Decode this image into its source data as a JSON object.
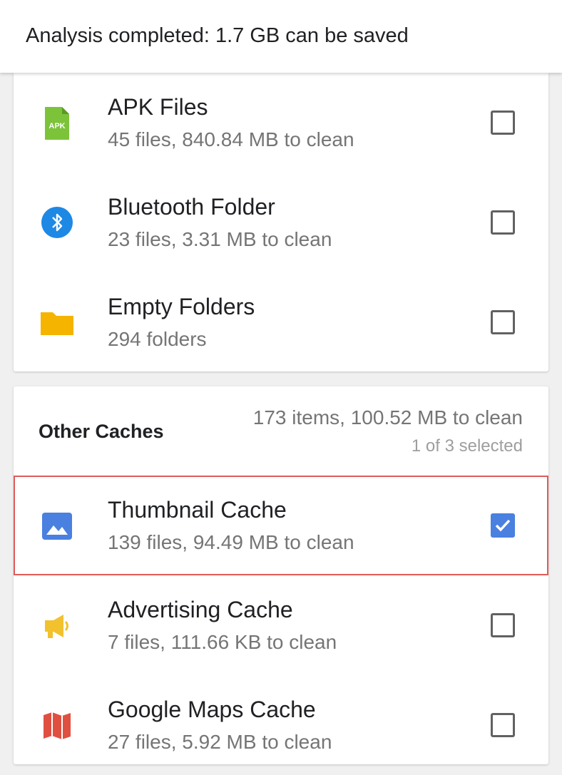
{
  "header": {
    "title": "Analysis completed: 1.7 GB can be saved"
  },
  "groups": [
    {
      "items": [
        {
          "label": "APK Files",
          "detail": "45 files, 840.84 MB to clean",
          "icon": "apk-file-icon",
          "checked": false
        },
        {
          "label": "Bluetooth Folder",
          "detail": "23 files, 3.31 MB to clean",
          "icon": "bluetooth-icon",
          "checked": false
        },
        {
          "label": "Empty Folders",
          "detail": "294 folders",
          "icon": "folder-icon",
          "checked": false
        }
      ]
    },
    {
      "title": "Other Caches",
      "summary": "173 items, 100.52 MB to clean",
      "selected": "1 of 3 selected",
      "items": [
        {
          "label": "Thumbnail Cache",
          "detail": "139 files, 94.49 MB to clean",
          "icon": "image-icon",
          "checked": true
        },
        {
          "label": "Advertising Cache",
          "detail": "7 files, 111.66 KB to clean",
          "icon": "megaphone-icon",
          "checked": false
        },
        {
          "label": "Google Maps Cache",
          "detail": "27 files, 5.92 MB to clean",
          "icon": "map-icon",
          "checked": false
        }
      ]
    }
  ],
  "colors": {
    "apk": "#7cc33a",
    "bluetooth": "#1e88e5",
    "folder": "#f5b400",
    "image": "#4a80e0",
    "megaphone": "#f2c12e",
    "map": "#e05040",
    "highlight": "#e05a5a"
  }
}
